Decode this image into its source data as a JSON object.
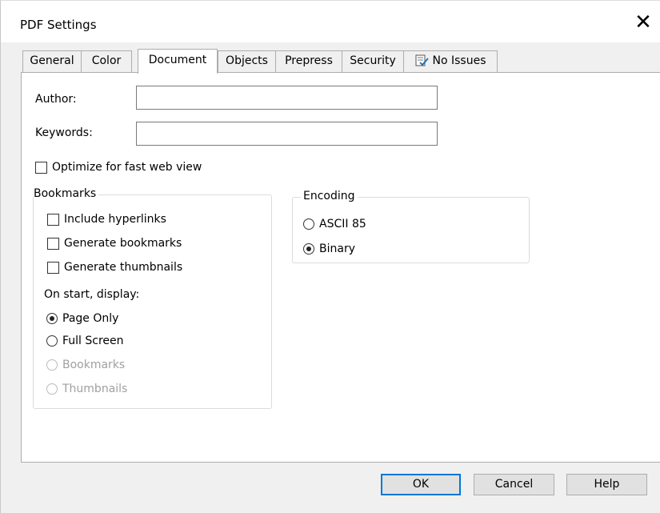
{
  "window": {
    "title": "PDF Settings"
  },
  "tabs": [
    {
      "label": "General"
    },
    {
      "label": "Color"
    },
    {
      "label": "Document"
    },
    {
      "label": "Objects"
    },
    {
      "label": "Prepress"
    },
    {
      "label": "Security"
    },
    {
      "label": "No Issues",
      "icon": "checklist-icon"
    }
  ],
  "active_tab": "Document",
  "document": {
    "author_label": "Author:",
    "author_value": "",
    "keywords_label": "Keywords:",
    "keywords_value": "",
    "optimize_label": "Optimize for fast web view",
    "optimize_checked": false,
    "bookmarks": {
      "title": "Bookmarks",
      "include_hyperlinks": "Include hyperlinks",
      "generate_bookmarks": "Generate bookmarks",
      "generate_thumbnails": "Generate thumbnails",
      "on_start_label": "On start, display:",
      "options": [
        "Page Only",
        "Full Screen",
        "Bookmarks",
        "Thumbnails"
      ],
      "selected": "Page Only"
    },
    "encoding": {
      "title": "Encoding",
      "options": [
        "ASCII 85",
        "Binary"
      ],
      "selected": "Binary"
    }
  },
  "buttons": {
    "ok": "OK",
    "cancel": "Cancel",
    "help": "Help"
  },
  "colors": {
    "accent": "#0078d7",
    "dialog_bg": "#f0f0f0",
    "disabled_text": "#a0a0a0"
  }
}
